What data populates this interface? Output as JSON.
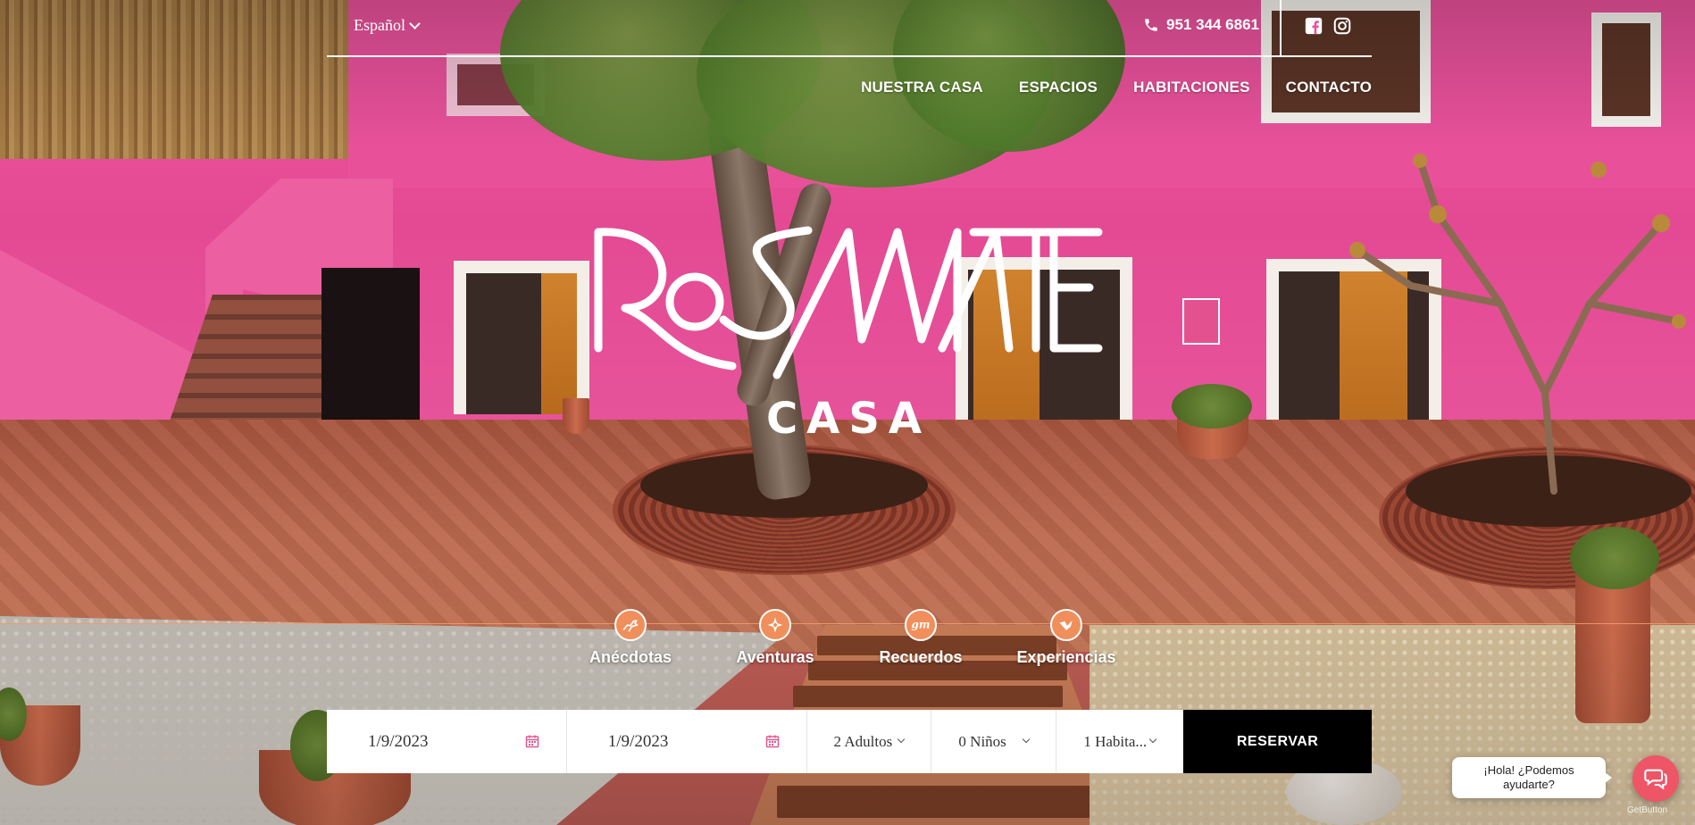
{
  "header": {
    "language": "Español",
    "phone": "951 344 6861",
    "social": [
      "facebook-icon",
      "instagram-icon"
    ]
  },
  "nav": {
    "items": [
      "NUESTRA CASA",
      "ESPACIOS",
      "HABITACIONES",
      "CONTACTO"
    ]
  },
  "logo": {
    "main": "ROSAMATE",
    "sub": "CASA"
  },
  "features": [
    {
      "label": "Anécdotas",
      "icon": "horse-icon"
    },
    {
      "label": "Aventuras",
      "icon": "compass-icon"
    },
    {
      "label": "Recuerdos",
      "icon": "gm-monogram-icon"
    },
    {
      "label": "Experiencias",
      "icon": "bird-icon"
    }
  ],
  "booking": {
    "check_in": "1/9/2023",
    "check_out": "1/9/2023",
    "adults": "2 Adultos",
    "children": "0 Niños",
    "rooms": "1 Habita...",
    "submit": "RESERVAR"
  },
  "chat": {
    "greeting_line1": "¡Hola! ¿Podemos",
    "greeting_line2": "ayudarte?",
    "powered_by": "GetButton"
  },
  "colors": {
    "accent": "#f18f5c",
    "wall_pink": "#e8519a",
    "chat": "#ee5567"
  }
}
